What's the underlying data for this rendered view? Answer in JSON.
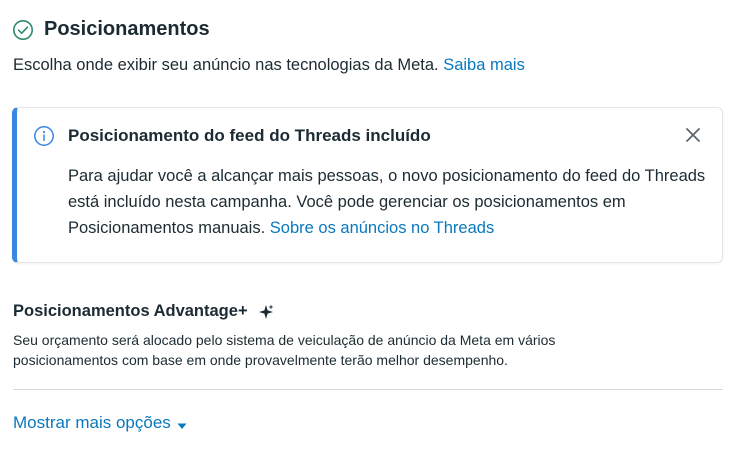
{
  "section": {
    "title": "Posicionamentos",
    "subtitle": "Escolha onde exibir seu anúncio nas tecnologias da Meta.",
    "subtitle_link": "Saiba mais"
  },
  "banner": {
    "title": "Posicionamento do feed do Threads incluído",
    "body": "Para ajudar você a alcançar mais pessoas, o novo posicionamento do feed do Threads está incluído nesta campanha. Você pode gerenciar os posicionamentos em Posicionamentos manuais.",
    "link": "Sobre os anúncios no Threads",
    "accent_color": "#3b86e0"
  },
  "advantage": {
    "title": "Posicionamentos Advantage+",
    "description": "Seu orçamento será alocado pelo sistema de veiculação de anúncio da Meta em vários posicionamentos com base em onde provavelmente terão melhor desempenho."
  },
  "footer": {
    "more_options": "Mostrar mais opções"
  },
  "icons": {
    "check": "check-circle-icon",
    "info": "info-icon",
    "close": "close-icon",
    "sparkle": "sparkle-icon",
    "caret": "caret-down-icon"
  },
  "colors": {
    "link": "#0a78be",
    "text": "#1c2b33",
    "check": "#2e8a6b"
  }
}
